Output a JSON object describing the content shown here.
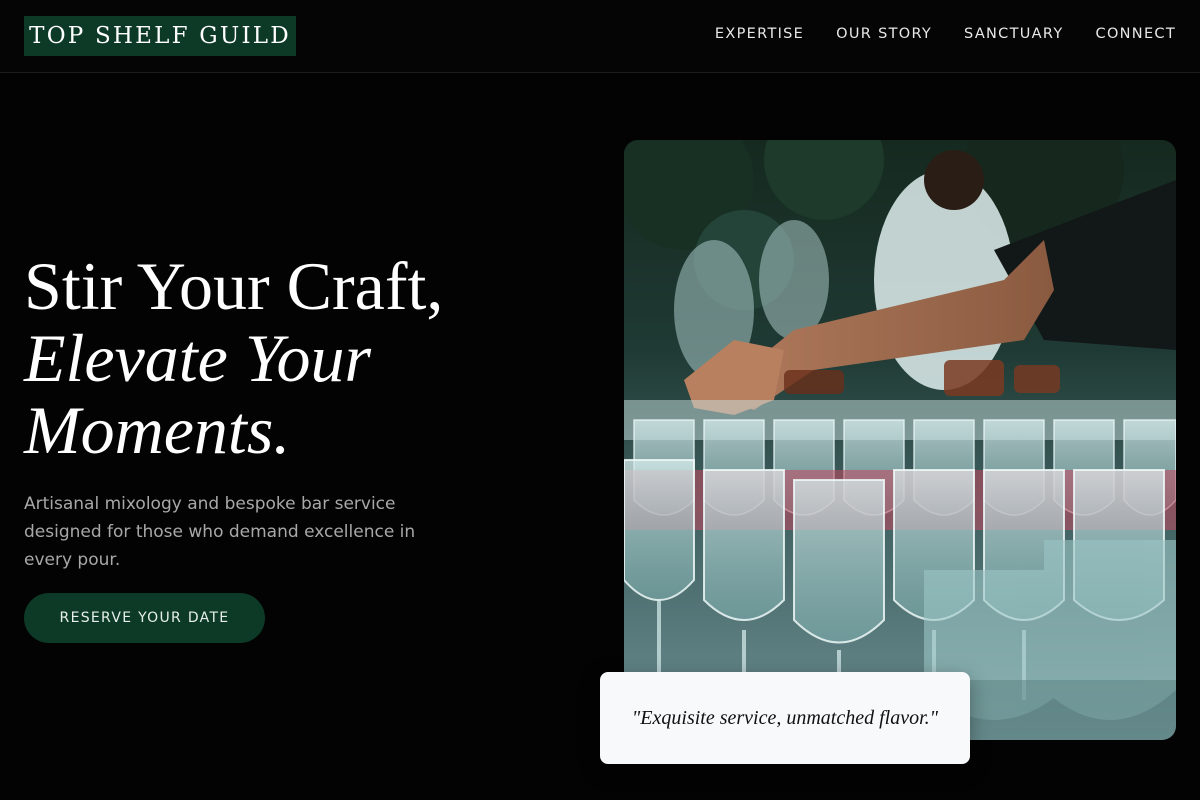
{
  "brand": {
    "name": "TOP SHELF GUILD"
  },
  "nav": {
    "items": [
      {
        "label": "EXPERTISE"
      },
      {
        "label": "OUR STORY"
      },
      {
        "label": "SANCTUARY"
      },
      {
        "label": "CONNECT"
      }
    ]
  },
  "hero": {
    "title_line1": "Stir Your Craft,",
    "title_line2": "Elevate Your",
    "title_line3": "Moments.",
    "subtitle": "Artisanal mixology and bespoke bar service designed for those who demand excellence in every pour.",
    "cta_label": "RESERVE YOUR DATE"
  },
  "image": {
    "subject": "bartender-pouring-wine-glasses-photo"
  },
  "testimonial": {
    "quote": "\"Exquisite service, unmatched flavor.\""
  },
  "colors": {
    "background": "#030303",
    "brand_green": "#0d3a27",
    "text_primary": "#ffffff",
    "text_muted": "#a8a8a8",
    "card_bg": "#f8f9fb"
  }
}
